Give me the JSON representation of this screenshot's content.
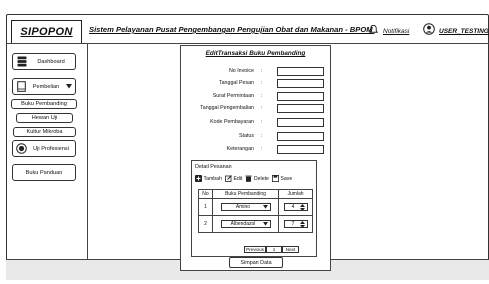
{
  "app": {
    "brand": "SIPOPON",
    "title": "Sistem Pelayanan Pusat Pengembangan Pengujian Obat dan Makanan - BPOM",
    "notification_label": "Notifikasi",
    "user_label": "USER_TESTING",
    "icons": {
      "notification": "bell-icon",
      "user": "user-avatar-icon"
    }
  },
  "sidebar": {
    "items": [
      {
        "label": "Dashboard",
        "icon": "database-icon"
      },
      {
        "label": "Pembelian",
        "icon": "document-icon",
        "has_dropdown": true
      },
      {
        "label": "Buku Pembanding"
      },
      {
        "label": "Hewan Uji"
      },
      {
        "label": "Kultur Mikroba"
      },
      {
        "label": "Uji Profesiensi",
        "icon": "target-icon"
      },
      {
        "label": "Buku Panduan"
      }
    ]
  },
  "form": {
    "title": "EditTransaksi Buku Pembanding",
    "fields": [
      {
        "label": "No Invoice",
        "value": ""
      },
      {
        "label": "Tanggal Pesan",
        "value": ""
      },
      {
        "label": "Surat Permintaan",
        "value": ""
      },
      {
        "label": "Tanggal Pengembalian",
        "value": ""
      },
      {
        "label": "Kode Pembayaran",
        "value": ""
      },
      {
        "label": "Status",
        "value": ""
      },
      {
        "label": "Keterangan",
        "value": ""
      }
    ],
    "colon": ":"
  },
  "detail": {
    "title": "Detail Pesanan",
    "toolbar": {
      "add": "Tambah",
      "edit": "Edit",
      "delete": "Delete",
      "save": "Save"
    },
    "columns": [
      "No",
      "Buku Pembanding",
      "Jumlah"
    ],
    "rows": [
      {
        "no": "1",
        "item": "Amino",
        "qty": "4"
      },
      {
        "no": "2",
        "item": "Albendazol",
        "qty": "7"
      }
    ],
    "pager": {
      "prev": "Previous",
      "page": "1",
      "next": "Next"
    }
  },
  "submit_label": "Simpan Data"
}
